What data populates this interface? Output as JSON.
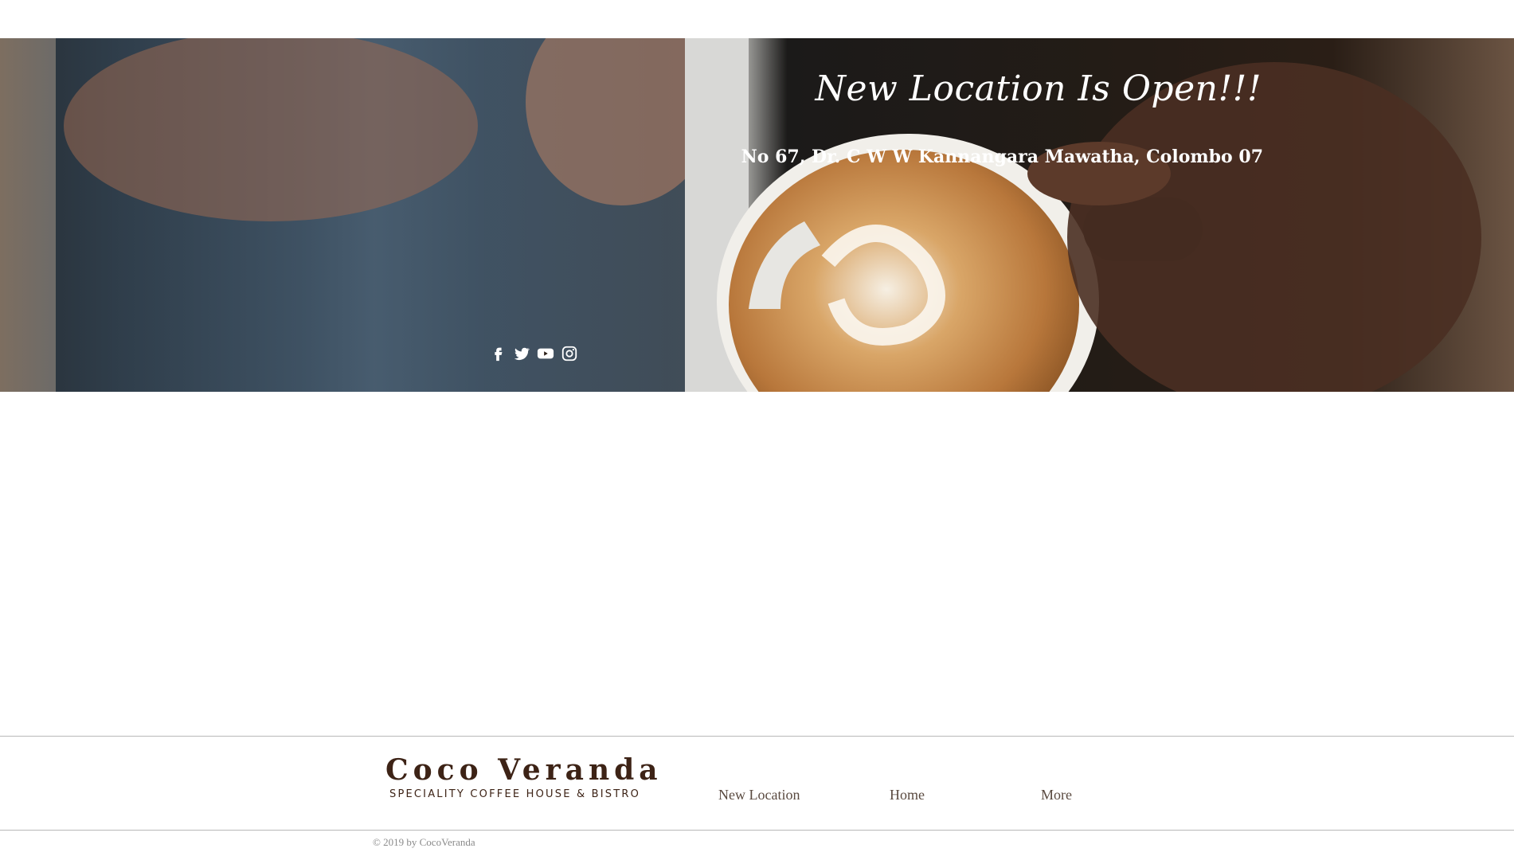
{
  "hero": {
    "title": "New Location Is Open!!!",
    "address": "No 67,  Dr. C W W Kannangara Mawatha, Colombo 07",
    "background_image": "latte-art-pouring-photo"
  },
  "social": {
    "icons": [
      "facebook-icon",
      "twitter-icon",
      "youtube-icon",
      "instagram-icon"
    ],
    "icon_color": "#ffffff"
  },
  "footer": {
    "brand": "Coco Veranda",
    "tagline": "SPECIALITY COFFEE HOUSE & BISTRO",
    "nav": [
      "New Location",
      "Home",
      "More"
    ],
    "copyright": "© 2019 by CocoVeranda",
    "brand_color": "#3d2316"
  }
}
